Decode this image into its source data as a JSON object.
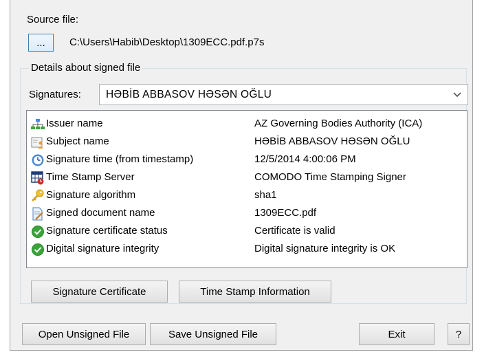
{
  "source": {
    "label": "Source file:",
    "browse_label": "...",
    "path": "C:\\Users\\Habib\\Desktop\\1309ECC.pdf.p7s"
  },
  "details": {
    "group_title": "Details about signed file",
    "signatures_label": "Signatures:",
    "selected_signature": "HƏBİB ABBASOV HƏSƏN OĞLU",
    "rows": [
      {
        "icon": "org-chart-icon",
        "label": "Issuer name",
        "value": "AZ Governing Bodies Authority (ICA)"
      },
      {
        "icon": "user-card-icon",
        "label": "Subject name",
        "value": "HƏBİB ABBASOV HƏSƏN OĞLU"
      },
      {
        "icon": "clock-icon",
        "label": "Signature time (from timestamp)",
        "value": "12/5/2014 4:00:06 PM"
      },
      {
        "icon": "calendar-clock-icon",
        "label": "Time Stamp Server",
        "value": "COMODO Time Stamping Signer"
      },
      {
        "icon": "key-icon",
        "label": "Signature algorithm",
        "value": "sha1"
      },
      {
        "icon": "document-pen-icon",
        "label": "Signed document name",
        "value": "1309ECC.pdf"
      },
      {
        "icon": "check-circle-icon",
        "label": "Signature certificate status",
        "value": "Certificate is valid"
      },
      {
        "icon": "check-circle-icon",
        "label": "Digital signature integrity",
        "value": "Digital signature integrity is OK"
      }
    ],
    "cert_button": "Signature Certificate",
    "timestamp_button": "Time Stamp Information"
  },
  "footer": {
    "open_unsigned": "Open Unsigned File",
    "save_unsigned": "Save Unsigned File",
    "exit": "Exit",
    "help": "?"
  },
  "colors": {
    "dialog_bg": "#f0f0f0",
    "check_green": "#3aa43a",
    "focus_blue": "#3c7fb1"
  }
}
